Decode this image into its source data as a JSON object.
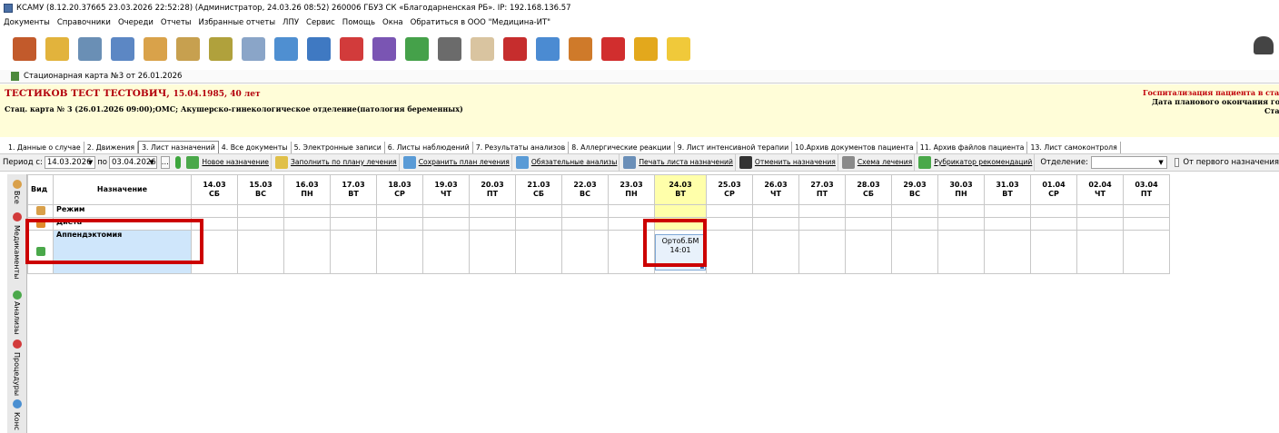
{
  "window": {
    "title": "КСАМУ (8.12.20.37665 23.03.2026 22:52:28) (Администратор, 24.03.26 08:52)  260006 ГБУЗ СК «Благодарненская РБ». IP: 192.168.136.57"
  },
  "menu": [
    "Документы",
    "Справочники",
    "Очереди",
    "Отчеты",
    "Избранные отчеты",
    "ЛПУ",
    "Сервис",
    "Помощь",
    "Окна",
    "Обратиться в ООО \"Медицина-ИТ\""
  ],
  "toolbar_icons": [
    {
      "name": "doctor-icon",
      "color": "#c25a2b"
    },
    {
      "name": "notepad-icon",
      "color": "#e2b33c"
    },
    {
      "name": "calculator-icon",
      "color": "#6a8fb5"
    },
    {
      "name": "card-icon",
      "color": "#5c87c4"
    },
    {
      "name": "hand-icon",
      "color": "#d9a24a"
    },
    {
      "name": "pencil-icon",
      "color": "#c7a04f"
    },
    {
      "name": "edit-icon",
      "color": "#b0a13c"
    },
    {
      "name": "syringe-icon",
      "color": "#8aa5c8"
    },
    {
      "name": "chart-icon",
      "color": "#4f8fd1"
    },
    {
      "name": "document-search-icon",
      "color": "#3f79c2"
    },
    {
      "name": "medical-kit-icon",
      "color": "#d23b3b"
    },
    {
      "name": "disk-icon",
      "color": "#7a55b3"
    },
    {
      "name": "mountain-icon",
      "color": "#45a14a"
    },
    {
      "name": "bars-icon",
      "color": "#6b6b6b"
    },
    {
      "name": "person-icon",
      "color": "#d9c4a0"
    },
    {
      "name": "book-icon",
      "color": "#c62d2d"
    },
    {
      "name": "calendar-icon",
      "color": "#4b8bd2"
    },
    {
      "name": "grid-icon",
      "color": "#cf7a2a"
    },
    {
      "name": "pdf-icon",
      "color": "#d12e2e"
    },
    {
      "name": "lock-icon",
      "color": "#e3a81c"
    },
    {
      "name": "chat-icon",
      "color": "#f0c93a"
    }
  ],
  "document_tab": "Стационарная карта №3 от 26.01.2026",
  "patient": {
    "name": "ТЕСТИКОВ ТЕСТ ТЕСТОВИЧ,",
    "dob_age": "15.04.1985, 40 лет",
    "card": "Стац. карта  № 3 (26.01.2026 09:00);ОМС; Акушерско-гинекологическое отделение(патология беременных)",
    "right_line1": "Госпитализация пациента в стацио",
    "right_line2": "Дата планового окончания госпі",
    "right_line3": "Ста"
  },
  "tabs": [
    "1. Данные о случае",
    "2. Движения",
    "3. Лист назначений",
    "4. Все документы",
    "5. Электронные записи",
    "6. Листы наблюдений",
    "7. Результаты анализов",
    "8. Аллергические реакции",
    "9. Лист интенсивной терапии",
    "10.Архив документов пациента",
    "11. Архив файлов пациента",
    "13. Лист самоконтроля"
  ],
  "active_tab_index": 2,
  "filter": {
    "period_label": "Период с:",
    "from": "14.03.2026",
    "to_label": "по",
    "to": "03.04.2026",
    "dots": "...",
    "department_label": "Отделение:",
    "department_value": "",
    "first_order_label": "От первого назначения"
  },
  "actions": [
    {
      "label": "Новое назначение",
      "icon": "new-order-icon",
      "color": "#4aa84a"
    },
    {
      "label": "Заполнить по плану лечения",
      "icon": "envelope-icon",
      "color": "#e0c049"
    },
    {
      "label": "Сохранить план лечения",
      "icon": "folder-icon",
      "color": "#5a9bd6"
    },
    {
      "label": "Обязательные анализы",
      "icon": "flask-icon",
      "color": "#5a9bd6"
    },
    {
      "label": "Печать листа назначений",
      "icon": "printer-icon",
      "color": "#6b8fb8"
    },
    {
      "label": "Отменить назначения",
      "icon": "cancel-icon",
      "color": "#333333"
    },
    {
      "label": "Схема лечения",
      "icon": "list-icon",
      "color": "#8a8a8a"
    },
    {
      "label": "Рубрикатор рекомендаций",
      "icon": "rubricator-icon",
      "color": "#4aa84a"
    }
  ],
  "side_tabs": [
    "Все",
    "Медикаменты",
    "Анализы",
    "Процедуры",
    "Конс"
  ],
  "grid": {
    "kind_header": "Вид",
    "name_header": "Назначение",
    "dates": [
      {
        "d": "14.03",
        "w": "СБ"
      },
      {
        "d": "15.03",
        "w": "ВС"
      },
      {
        "d": "16.03",
        "w": "ПН"
      },
      {
        "d": "17.03",
        "w": "ВТ"
      },
      {
        "d": "18.03",
        "w": "СР"
      },
      {
        "d": "19.03",
        "w": "ЧТ"
      },
      {
        "d": "20.03",
        "w": "ПТ"
      },
      {
        "d": "21.03",
        "w": "СБ"
      },
      {
        "d": "22.03",
        "w": "ВС"
      },
      {
        "d": "23.03",
        "w": "ПН"
      },
      {
        "d": "24.03",
        "w": "ВТ"
      },
      {
        "d": "25.03",
        "w": "СР"
      },
      {
        "d": "26.03",
        "w": "ЧТ"
      },
      {
        "d": "27.03",
        "w": "ПТ"
      },
      {
        "d": "28.03",
        "w": "СБ"
      },
      {
        "d": "29.03",
        "w": "ВС"
      },
      {
        "d": "30.03",
        "w": "ПН"
      },
      {
        "d": "31.03",
        "w": "ВТ"
      },
      {
        "d": "01.04",
        "w": "СР"
      },
      {
        "d": "02.04",
        "w": "ЧТ"
      },
      {
        "d": "03.04",
        "w": "ПТ"
      }
    ],
    "today_index": 10,
    "rows": [
      {
        "name": "Режим",
        "icon": "regime-icon",
        "order": null
      },
      {
        "name": "Диета",
        "icon": "diet-icon",
        "order": null
      },
      {
        "name": "Аппендэктомия",
        "icon": "surgery-icon",
        "order": {
          "col": 10,
          "line1": "Ортоб.БМ",
          "line2": "14:01"
        }
      }
    ]
  }
}
